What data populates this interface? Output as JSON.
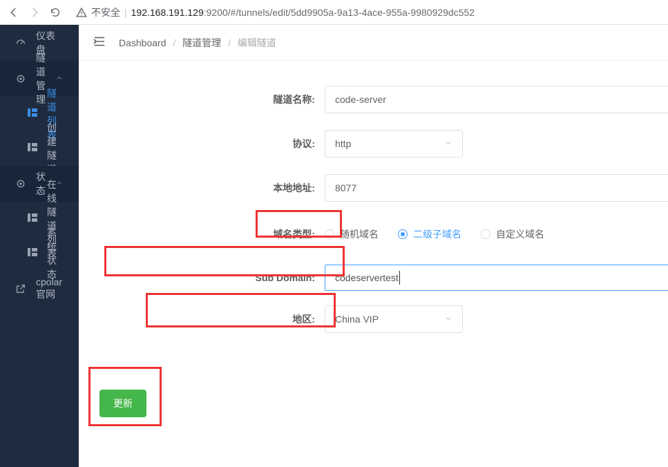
{
  "browser": {
    "insecure_label": "不安全",
    "url_host": "192.168.191.129",
    "url_rest": ":9200/#/tunnels/edit/5dd9905a-9a13-4ace-955a-9980929dc552"
  },
  "sidebar": {
    "dashboard": "仪表盘",
    "tunnel_mgr": "隧道管理",
    "tunnel_list": "隧道列表",
    "create_tunnel": "创建隧道",
    "status": "状态",
    "online_tunnel_list": "在线隧道列表",
    "system_status": "系统状态",
    "cpolar": "cpolar官网"
  },
  "breadcrumbs": {
    "a": "Dashboard",
    "b": "隧道管理",
    "c": "编辑隧道"
  },
  "form": {
    "name_label": "隧道名称:",
    "name_value": "code-server",
    "proto_label": "协议:",
    "proto_value": "http",
    "localaddr_label": "本地地址:",
    "localaddr_value": "8077",
    "domain_type_label": "域名类型:",
    "radio_random": "随机域名",
    "radio_sub": "二级子域名",
    "radio_custom": "自定义域名",
    "subdomain_label": "Sub Domain:",
    "subdomain_value": "codeservertest",
    "region_label": "地区:",
    "region_value": "China VIP",
    "submit": "更新"
  }
}
